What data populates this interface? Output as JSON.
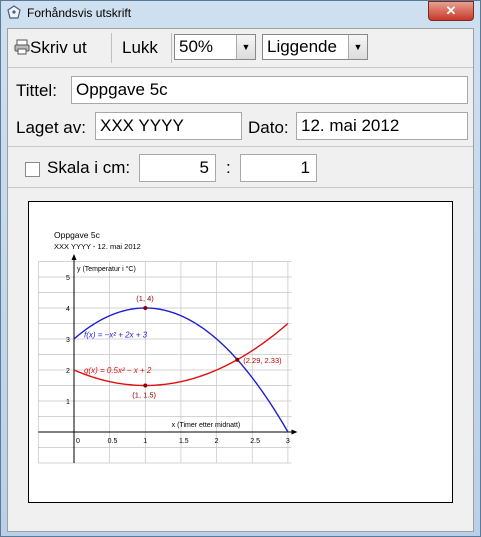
{
  "window": {
    "title": "Forhåndsvis utskrift",
    "close_label": "✕"
  },
  "toolbar": {
    "print_label": "Skriv ut",
    "close_label": "Lukk",
    "zoom_value": "50%",
    "orientation_value": "Liggende"
  },
  "form": {
    "title_label": "Tittel:",
    "title_value": "Oppgave 5c",
    "author_label": "Laget av:",
    "author_value": "XXX YYYY",
    "date_label": "Dato:",
    "date_value": "12. mai 2012",
    "scale_label": "Skala i cm:",
    "scale_checked": false,
    "scale_left": "5",
    "scale_colon": ":",
    "scale_right": "1"
  },
  "preview": {
    "heading": "Oppgave 5c",
    "subheading": "XXX YYYY - 12. mai 2012"
  },
  "chart_data": {
    "type": "line",
    "xlabel": "x (Timer etter midnatt)",
    "ylabel": "y (Temperatur i °C)",
    "xlim": [
      0,
      3
    ],
    "ylim": [
      0,
      5
    ],
    "x_ticks": [
      "0",
      "0.5",
      "1",
      "1.5",
      "2",
      "2.5",
      "3"
    ],
    "y_ticks": [
      "1",
      "2",
      "3",
      "4",
      "5"
    ],
    "grid": true,
    "series": [
      {
        "name": "f(x) = −x² + 2x + 3",
        "color": "#1f1fd0",
        "x": [
          0,
          0.25,
          0.5,
          0.75,
          1,
          1.25,
          1.5,
          1.75,
          2,
          2.25,
          2.5,
          2.75,
          3
        ],
        "y": [
          3,
          3.4375,
          3.75,
          3.9375,
          4,
          3.9375,
          3.75,
          3.4375,
          3,
          2.4375,
          1.75,
          0.9375,
          0
        ]
      },
      {
        "name": "g(x) = 0.5x² − x + 2",
        "color": "#e01010",
        "x": [
          0,
          0.25,
          0.5,
          0.75,
          1,
          1.25,
          1.5,
          1.75,
          2,
          2.25,
          2.5,
          2.75,
          3
        ],
        "y": [
          2,
          1.78125,
          1.625,
          1.53125,
          1.5,
          1.53125,
          1.625,
          1.78125,
          2,
          2.28125,
          2.625,
          3.03125,
          3.5
        ]
      }
    ],
    "points": [
      {
        "x": 1,
        "y": 4,
        "label": "(1, 4)"
      },
      {
        "x": 1,
        "y": 1.5,
        "label": "(1, 1.5)"
      },
      {
        "x": 2.29,
        "y": 2.33,
        "label": "(2.29, 2.33)"
      }
    ]
  }
}
